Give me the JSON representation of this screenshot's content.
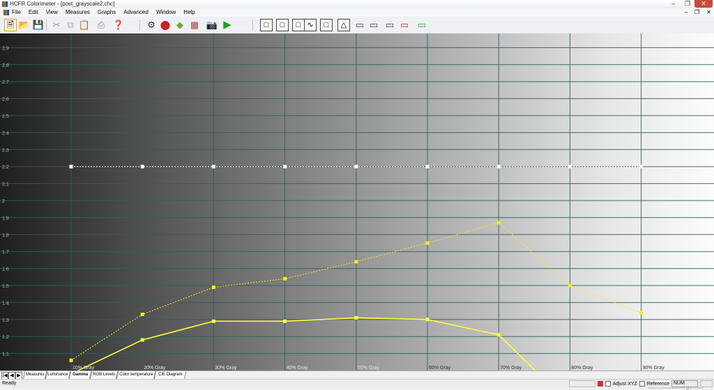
{
  "window": {
    "title": "HCFR Colorimeter - [post_grayscale2.chc]"
  },
  "menu": [
    "File",
    "Edit",
    "View",
    "Measures",
    "Graphs",
    "Advanced",
    "Window",
    "Help"
  ],
  "tabs": [
    {
      "label": "Measures",
      "active": false
    },
    {
      "label": "Luminance",
      "active": false
    },
    {
      "label": "Gamma",
      "active": true
    },
    {
      "label": "RGB Levels",
      "active": false
    },
    {
      "label": "Color temperature",
      "active": false
    },
    {
      "label": "CIE Diagram",
      "active": false
    }
  ],
  "status": {
    "text": "Ready",
    "adjust_label": "Adjust XYZ",
    "reference_label": "Reference",
    "num_label": "NUM"
  },
  "watermark": "hcfr.sourceforge.net",
  "chart_data": {
    "type": "line",
    "categories": [
      "10% Gray",
      "20% Gray",
      "30% Gray",
      "40% Gray",
      "50% Gray",
      "60% Gray",
      "70% Gray",
      "80% Gray",
      "90% Gray"
    ],
    "ylim": [
      1.0,
      3.0
    ],
    "yticks": [
      "1.1",
      "1.2",
      "1.3",
      "1.4",
      "1.5",
      "1.6",
      "1.7",
      "1.8",
      "1.9",
      "2",
      "2.1",
      "2.2",
      "2.3",
      "2.4",
      "2.5",
      "2.6",
      "2.7",
      "2.8",
      "2.9"
    ],
    "grid": true,
    "series": [
      {
        "values": [
          2.2,
          2.2,
          2.2,
          2.2,
          2.2,
          2.2,
          2.2,
          2.2,
          2.2
        ],
        "color": "#ffffff",
        "style": "dotted-markers"
      },
      {
        "values": [
          1.06,
          1.33,
          1.49,
          1.54,
          1.64,
          1.75,
          1.87,
          1.5,
          1.34
        ],
        "color": "#f5f01a",
        "style": "dotted-markers"
      },
      {
        "values": [
          0.98,
          1.18,
          1.29,
          1.29,
          1.31,
          1.3,
          1.21,
          0.8,
          null
        ],
        "color": "#ffff3a",
        "style": "solid-markers"
      }
    ]
  }
}
